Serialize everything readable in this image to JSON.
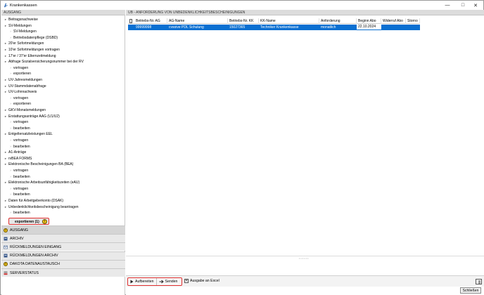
{
  "window": {
    "title": "Krankenkassen",
    "minimize": "—",
    "maximize": "□",
    "close": "✕"
  },
  "left": {
    "header": "AUSGANG",
    "tree": [
      {
        "label": "Beitragsnachweise",
        "level": 0,
        "marker": "expand"
      },
      {
        "label": "SV-Meldungen",
        "level": 0,
        "marker": "expand"
      },
      {
        "label": "SV-Meldungen",
        "level": 1,
        "marker": "chevron"
      },
      {
        "label": "Betriebsdatenpflege (DSBD)",
        "level": 1,
        "marker": "chevron"
      },
      {
        "label": "20'er Sofortmeldungen",
        "level": 0,
        "marker": "expand"
      },
      {
        "label": "10'er Sofortmeldungen vortragen",
        "level": 0,
        "marker": "expand"
      },
      {
        "label": "17'er / 37'er Elternzeitmeldung",
        "level": 0,
        "marker": "expand"
      },
      {
        "label": "Abfrage Sozialversicherungsnummer bei der RV",
        "level": 0,
        "marker": "expand"
      },
      {
        "label": "vortragen",
        "level": 1,
        "marker": "chevron"
      },
      {
        "label": "exportieren",
        "level": 1,
        "marker": "chevron"
      },
      {
        "label": "UV-Jahresmeldungen",
        "level": 0,
        "marker": "expand"
      },
      {
        "label": "UV-Stammdatenabfrage",
        "level": 0,
        "marker": "expand"
      },
      {
        "label": "UV-Lohnnachweis",
        "level": 0,
        "marker": "expand"
      },
      {
        "label": "vortragen",
        "level": 1,
        "marker": "chevron"
      },
      {
        "label": "exportieren",
        "level": 1,
        "marker": "chevron"
      },
      {
        "label": "GKV-Monatsmeldungen",
        "level": 0,
        "marker": "expand"
      },
      {
        "label": "Erstattungsanträge AAG (U1/U2)",
        "level": 0,
        "marker": "expand"
      },
      {
        "label": "vortragen",
        "level": 1,
        "marker": "chevron"
      },
      {
        "label": "bearbeiten",
        "level": 1,
        "marker": "chevron"
      },
      {
        "label": "Entgeltersatzleistungen EEL",
        "level": 0,
        "marker": "expand"
      },
      {
        "label": "vortragen",
        "level": 1,
        "marker": "chevron"
      },
      {
        "label": "bearbeiten",
        "level": 1,
        "marker": "chevron"
      },
      {
        "label": "A1-Anträge",
        "level": 0,
        "marker": "expand"
      },
      {
        "label": "rvBEA FORMS",
        "level": 0,
        "marker": "expand"
      },
      {
        "label": "Elektronische Bescheinigungen BA (BEA)",
        "level": 0,
        "marker": "expand"
      },
      {
        "label": "vortragen",
        "level": 1,
        "marker": "chevron"
      },
      {
        "label": "bearbeiten",
        "level": 1,
        "marker": "chevron"
      },
      {
        "label": "Elektronische Arbeitsunfähigkeitszeiten (eAU)",
        "level": 0,
        "marker": "expand"
      },
      {
        "label": "vortragen",
        "level": 1,
        "marker": "chevron"
      },
      {
        "label": "bearbeiten",
        "level": 1,
        "marker": "chevron"
      },
      {
        "label": "Daten für Arbeitgeberkonto (DSAK)",
        "level": 0,
        "marker": "expand"
      },
      {
        "label": "Unbedenklichkeitsbescheinigung beantragen",
        "level": 0,
        "marker": "expand"
      },
      {
        "label": "bearbeiten",
        "level": 1,
        "marker": "chevron"
      }
    ],
    "selected_item": {
      "label": "exportieren (1)",
      "warn": "!"
    },
    "nav": [
      {
        "label": "AUSGANG",
        "icon": "warning-icon",
        "active": true
      },
      {
        "label": "ARCHIV",
        "icon": "archive-icon",
        "active": false
      },
      {
        "label": "RÜCKMELDUNGEN EINGANG",
        "icon": "inbox-icon",
        "active": false
      },
      {
        "label": "RÜCKMELDUNGEN ARCHIV",
        "icon": "archive-icon",
        "active": false
      },
      {
        "label": "DAKOTA DATENAUSTAUSCH",
        "icon": "warning-icon",
        "active": false
      },
      {
        "label": "SERVERSTATUS",
        "icon": "server-icon",
        "active": false
      }
    ],
    "glyphs": {
      "expand": "▸",
      "chevron": "›",
      "warn": "!"
    }
  },
  "right": {
    "header": "UB - ANFORDERUNG VON UNBEDENKLICHKEITSBESCHEINIGUNGEN",
    "columns": [
      "Betriebs-Nr. AG",
      "AG-Name",
      "Betriebs-Nr. KK",
      "KK-Name",
      "Anforderung",
      "Beginn Abo",
      "Widerruf Abo",
      "Storno"
    ],
    "rows": [
      [
        "99999998",
        "cvsoive PDL Schulung",
        "15027365",
        "Techniker Krankenkasse",
        "monatlich",
        "22.10.2024",
        "",
        ""
      ]
    ]
  },
  "toolbar": {
    "aufbereiten": "Aufbereiten",
    "senden": "Senden",
    "excel_label": "Ausgabe an Excel",
    "excel_checked": true,
    "check_mark": "✕"
  },
  "footer": {
    "close_label": "Schließen"
  },
  "colors": {
    "selection": "#0a6fd1",
    "highlight_border": "#e03030",
    "warning": "#f3c614"
  }
}
